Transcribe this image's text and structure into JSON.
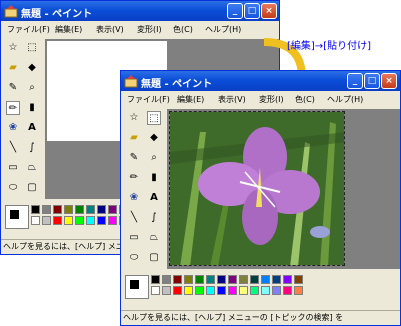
{
  "back_window": {
    "title": "無題 - ペイント",
    "menu": [
      "ファイル(F)",
      "編集(E)",
      "表示(V)",
      "変形(I)",
      "色(C)",
      "ヘルプ(H)"
    ],
    "status": "ヘルプを見るには、[ヘルプ] メニューの"
  },
  "front_window": {
    "title": "無題 - ペイント",
    "menu": [
      "ファイル(F)",
      "編集(E)",
      "表示(V)",
      "変形(I)",
      "色(C)",
      "ヘルプ(H)"
    ],
    "status": "ヘルプを見るには、[ヘルプ] メニューの [トピックの検索] を"
  },
  "annotation": "[編集]→[貼り付け]",
  "palette_colors": [
    "#000000",
    "#808080",
    "#800000",
    "#808000",
    "#008000",
    "#008080",
    "#000080",
    "#800080",
    "#808040",
    "#004040",
    "#0080ff",
    "#004080",
    "#8000ff",
    "#804000",
    "#ffffff",
    "#c0c0c0",
    "#ff0000",
    "#ffff00",
    "#00ff00",
    "#00ffff",
    "#0000ff",
    "#ff00ff",
    "#ffff80",
    "#00ff80",
    "#80ffff",
    "#8080ff",
    "#ff0080",
    "#ff8040"
  ],
  "window_buttons": {
    "minimize": "_",
    "maximize": "□",
    "close": "×"
  }
}
